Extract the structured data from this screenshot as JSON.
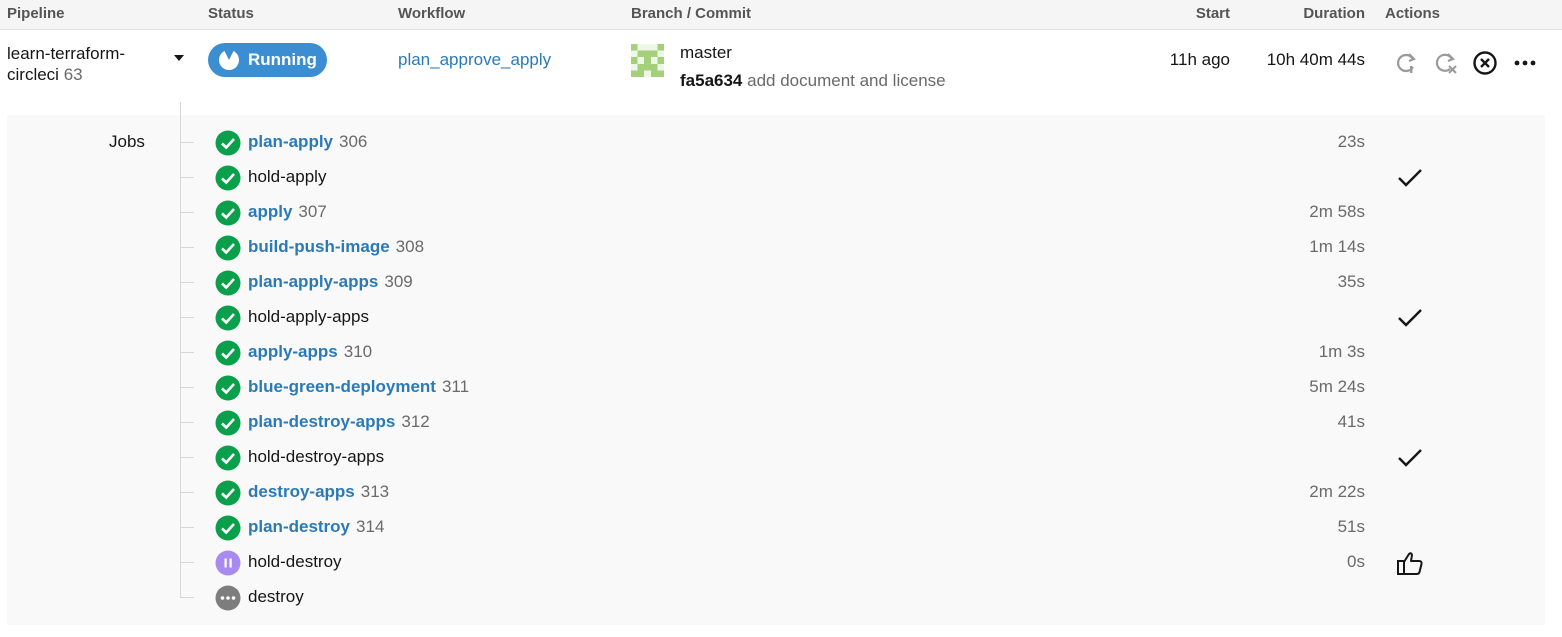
{
  "header": {
    "pipeline": "Pipeline",
    "status": "Status",
    "workflow": "Workflow",
    "branch_commit": "Branch / Commit",
    "start": "Start",
    "duration": "Duration",
    "actions": "Actions"
  },
  "pipeline": {
    "name_line1": "learn-terraform-",
    "name_line2": "circleci",
    "number": "63",
    "status": "Running",
    "status_color": "#3b8ed2",
    "workflow": "plan_approve_apply",
    "branch": "master",
    "commit_sha": "fa5a634",
    "commit_message": "add document and license",
    "start": "11h ago",
    "duration": "10h 40m 44s",
    "actions": [
      "rerun-icon",
      "rerun-failed-icon",
      "cancel-icon",
      "more-icon"
    ]
  },
  "jobs_label": "Jobs",
  "colors": {
    "link": "#2a7ab9",
    "success": "#0a9f4b",
    "on_hold": "#a78bf0",
    "not_run": "#7d7d7d"
  },
  "jobs": [
    {
      "name": "plan-apply",
      "number": "306",
      "duration": "23s",
      "status": "success",
      "link": true,
      "action": ""
    },
    {
      "name": "hold-apply",
      "number": "",
      "duration": "",
      "status": "success",
      "link": false,
      "action": "approved-check-icon"
    },
    {
      "name": "apply",
      "number": "307",
      "duration": "2m 58s",
      "status": "success",
      "link": true,
      "action": ""
    },
    {
      "name": "build-push-image",
      "number": "308",
      "duration": "1m 14s",
      "status": "success",
      "link": true,
      "action": ""
    },
    {
      "name": "plan-apply-apps",
      "number": "309",
      "duration": "35s",
      "status": "success",
      "link": true,
      "action": ""
    },
    {
      "name": "hold-apply-apps",
      "number": "",
      "duration": "",
      "status": "success",
      "link": false,
      "action": "approved-check-icon"
    },
    {
      "name": "apply-apps",
      "number": "310",
      "duration": "1m 3s",
      "status": "success",
      "link": true,
      "action": ""
    },
    {
      "name": "blue-green-deployment",
      "number": "311",
      "duration": "5m 24s",
      "status": "success",
      "link": true,
      "action": ""
    },
    {
      "name": "plan-destroy-apps",
      "number": "312",
      "duration": "41s",
      "status": "success",
      "link": true,
      "action": ""
    },
    {
      "name": "hold-destroy-apps",
      "number": "",
      "duration": "",
      "status": "success",
      "link": false,
      "action": "approved-check-icon"
    },
    {
      "name": "destroy-apps",
      "number": "313",
      "duration": "2m 22s",
      "status": "success",
      "link": true,
      "action": ""
    },
    {
      "name": "plan-destroy",
      "number": "314",
      "duration": "51s",
      "status": "success",
      "link": true,
      "action": ""
    },
    {
      "name": "hold-destroy",
      "number": "",
      "duration": "0s",
      "status": "on_hold",
      "link": false,
      "action": "approve-thumbs-up-icon"
    },
    {
      "name": "destroy",
      "number": "",
      "duration": "",
      "status": "not_run",
      "link": false,
      "action": ""
    }
  ]
}
